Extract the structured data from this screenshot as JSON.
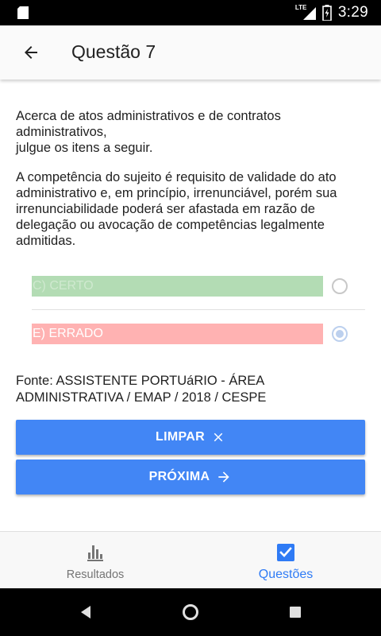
{
  "status_bar": {
    "time": "3:29",
    "network": "LTE",
    "icons": [
      "sd-card-icon",
      "signal-icon",
      "battery-charging-icon"
    ]
  },
  "app_bar": {
    "title": "Questão 7",
    "back_icon": "arrow-left-icon"
  },
  "question": {
    "intro": "Acerca de atos administrativos e de contratos administrativos,\njulgue os itens a seguir.",
    "statement": "A competência do sujeito é requisito de validade do ato administrativo e, em princípio, irrenunciável, porém sua irrenunciabilidade poderá ser afastada em razão de delegação ou avocação de competências legalmente admitidas.",
    "options": [
      {
        "label": "C) CERTO",
        "color": "#b3dcb4",
        "text_color": "#cfe9cf",
        "selected": false
      },
      {
        "label": "E) ERRADO",
        "color": "#ffb2b2",
        "text_color": "#ffffff",
        "selected": true
      }
    ],
    "source": "Fonte: ASSISTENTE PORTUáRIO - ÁREA ADMINISTRATIVA / EMAP / 2018 / CESPE"
  },
  "actions": {
    "clear_label": "LIMPAR",
    "clear_icon": "close-icon",
    "next_label": "PRÓXIMA",
    "next_icon": "arrow-right-icon",
    "button_color": "#4286f5"
  },
  "bottom_nav": {
    "items": [
      {
        "label": "Resultados",
        "icon": "bar-chart-icon",
        "active": false
      },
      {
        "label": "Questões",
        "icon": "checkbox-icon",
        "active": true
      }
    ],
    "active_color": "#2f7bf5"
  },
  "system_nav": {
    "icons": [
      "back-triangle-icon",
      "home-circle-icon",
      "recents-square-icon"
    ]
  }
}
